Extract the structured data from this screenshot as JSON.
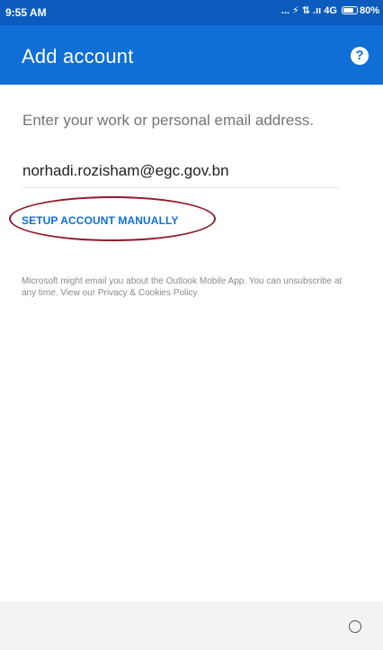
{
  "status_bar": {
    "time": "9:55 AM",
    "signal_text": "... ⚡ ⇅ .ıı 4G",
    "battery_percent": "80%",
    "battery_level": 0.8
  },
  "app_bar": {
    "title": "Add account",
    "help_icon": "?"
  },
  "form": {
    "prompt": "Enter your work or personal email address.",
    "email_value": "norhadi.rozisham@egc.gov.bn",
    "manual_setup_label": "SETUP ACCOUNT MANUALLY"
  },
  "disclaimer": "Microsoft might email you about the Outlook Mobile App. You can unsubscribe at any time. View our Privacy & Cookies Policy.",
  "colors": {
    "status_bar": "#0b5cbd",
    "app_bar": "#0f6fd6",
    "link": "#0f6fd6",
    "annotation": "#8e1b2e"
  }
}
